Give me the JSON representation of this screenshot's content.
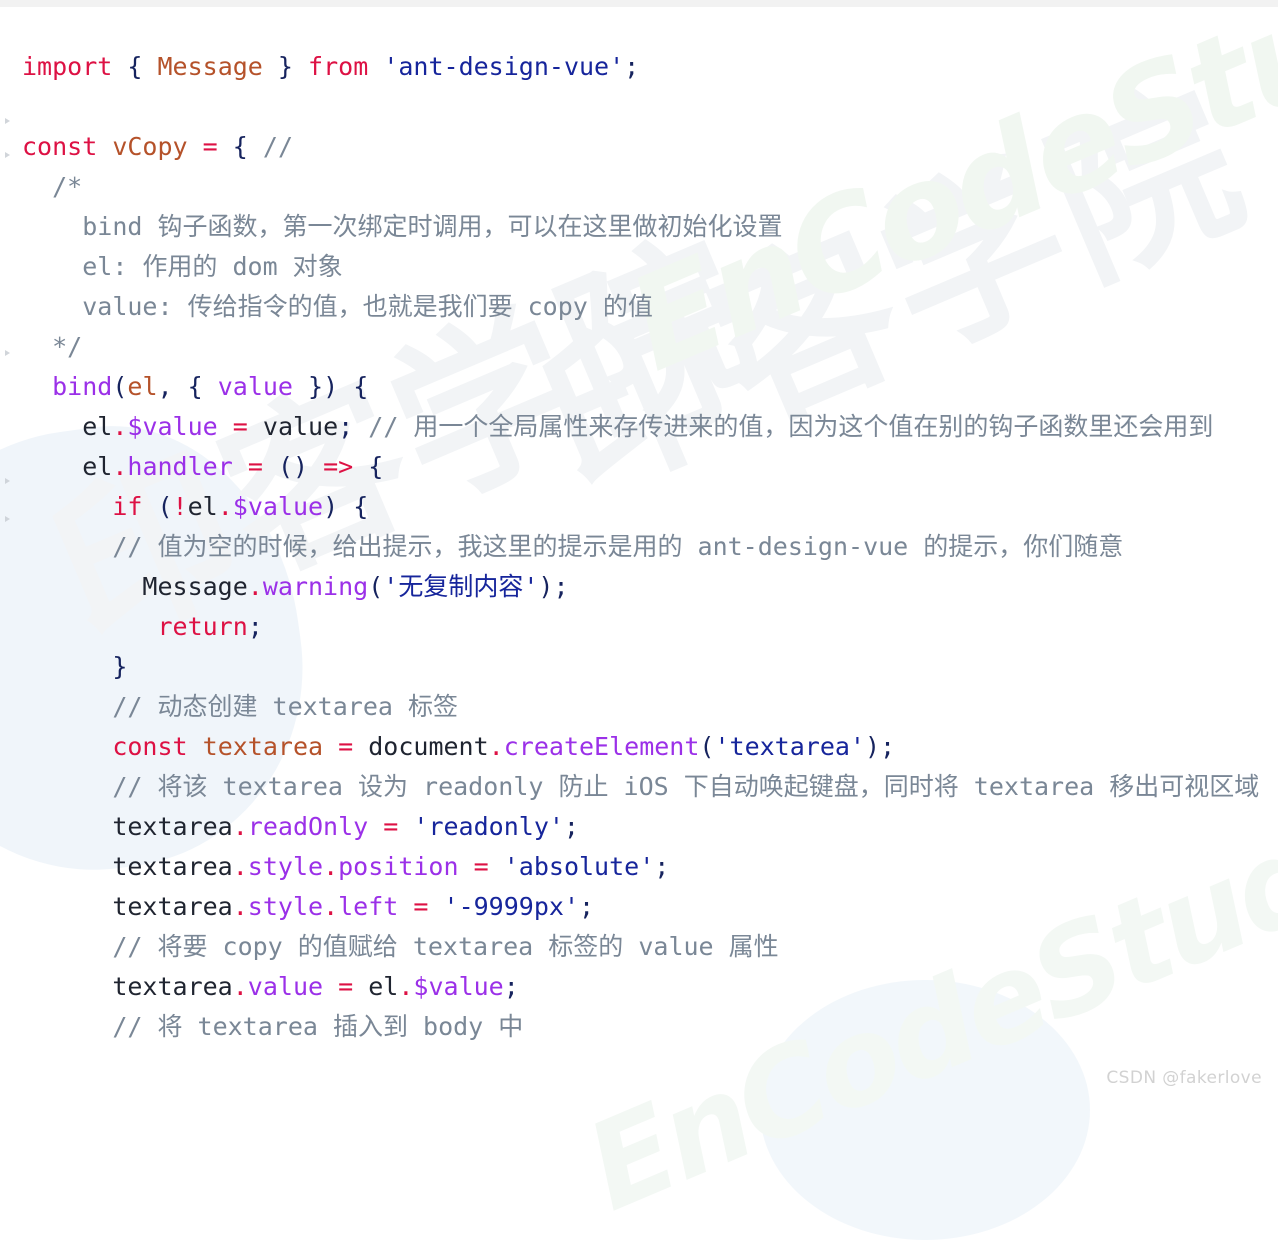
{
  "page": {
    "background_color": "#ffffff",
    "top_strip_color": "#f2f2f2"
  },
  "watermarks": {
    "brand_latin": "EnCodeStudio",
    "brand_cn": "印客学院",
    "latin_color": "#f1f7f1",
    "cn_color": "#f2f4f6"
  },
  "attribution": {
    "text": "CSDN @fakerlove",
    "color": "#d2d2d2"
  },
  "gutter": {
    "marker_name": "code-fold-arrow",
    "marker_color": "#c9ced4",
    "marker_tops": [
      118,
      152,
      350,
      478,
      516
    ]
  },
  "syntax_colors": {
    "keyword": "#dd1144",
    "string": "#16259b",
    "comment": "#7a8796",
    "property": "#9b30e8",
    "identifier": "#1f2430",
    "class": "#b5522a",
    "punctuation": "#16235e"
  },
  "code": {
    "language": "javascript",
    "lines": [
      {
        "id": "line-import",
        "tokens": [
          {
            "t": "import",
            "c": "k"
          },
          {
            "t": " ",
            "c": "pun"
          },
          {
            "t": "{",
            "c": "pun"
          },
          {
            "t": " ",
            "c": "pun"
          },
          {
            "t": "Message",
            "c": "cls"
          },
          {
            "t": " ",
            "c": "pun"
          },
          {
            "t": "}",
            "c": "pun"
          },
          {
            "t": " ",
            "c": "pun"
          },
          {
            "t": "from",
            "c": "k"
          },
          {
            "t": " ",
            "c": "pun"
          },
          {
            "t": "'ant-design-vue'",
            "c": "str"
          },
          {
            "t": ";",
            "c": "pun"
          }
        ]
      },
      {
        "id": "line-blank-1",
        "blank": true
      },
      {
        "id": "line-const-vcopy",
        "tokens": [
          {
            "t": "const",
            "c": "k"
          },
          {
            "t": " ",
            "c": "pun"
          },
          {
            "t": "vCopy",
            "c": "cls"
          },
          {
            "t": " ",
            "c": "pun"
          },
          {
            "t": "=",
            "c": "op"
          },
          {
            "t": " ",
            "c": "pun"
          },
          {
            "t": "{",
            "c": "pun"
          },
          {
            "t": " ",
            "c": "pun"
          },
          {
            "t": "//",
            "c": "cmt"
          }
        ]
      },
      {
        "id": "line-comment-open",
        "tokens": [
          {
            "t": "  /*",
            "c": "cmt"
          }
        ]
      },
      {
        "id": "line-comment-bind",
        "tokens": [
          {
            "t": "    bind 钩子函数，第一次绑定时调用，可以在这里做初始化设置",
            "c": "cmt"
          }
        ]
      },
      {
        "id": "line-comment-el",
        "tokens": [
          {
            "t": "    el: 作用的 dom 对象",
            "c": "cmt"
          }
        ]
      },
      {
        "id": "line-comment-value",
        "tokens": [
          {
            "t": "    value: 传给指令的值，也就是我们要 copy 的值",
            "c": "cmt"
          }
        ]
      },
      {
        "id": "line-comment-close",
        "tokens": [
          {
            "t": "  */",
            "c": "cmt"
          }
        ]
      },
      {
        "id": "line-bind-signature",
        "tokens": [
          {
            "t": "  ",
            "c": "pun"
          },
          {
            "t": "bind",
            "c": "fn"
          },
          {
            "t": "(",
            "c": "pun"
          },
          {
            "t": "el",
            "c": "cls"
          },
          {
            "t": ", ",
            "c": "pun"
          },
          {
            "t": "{ ",
            "c": "pun"
          },
          {
            "t": "value",
            "c": "prop"
          },
          {
            "t": " }",
            "c": "pun"
          },
          {
            "t": ") ",
            "c": "pun"
          },
          {
            "t": "{",
            "c": "pun"
          }
        ]
      },
      {
        "id": "line-el-value-assign",
        "tokens": [
          {
            "t": "    ",
            "c": "pun"
          },
          {
            "t": "el",
            "c": "var"
          },
          {
            "t": ".",
            "c": "dot"
          },
          {
            "t": "$value",
            "c": "prop"
          },
          {
            "t": " ",
            "c": "pun"
          },
          {
            "t": "=",
            "c": "op"
          },
          {
            "t": " ",
            "c": "pun"
          },
          {
            "t": "value",
            "c": "var"
          },
          {
            "t": ";",
            "c": "pun"
          },
          {
            "t": " // 用一个全局属性来存传进来的值，因为这个值在别的钩子函数里还会用到",
            "c": "cmt"
          }
        ]
      },
      {
        "id": "line-el-handler",
        "tokens": [
          {
            "t": "    ",
            "c": "pun"
          },
          {
            "t": "el",
            "c": "var"
          },
          {
            "t": ".",
            "c": "dot"
          },
          {
            "t": "handler",
            "c": "prop"
          },
          {
            "t": " ",
            "c": "pun"
          },
          {
            "t": "=",
            "c": "op"
          },
          {
            "t": " ",
            "c": "pun"
          },
          {
            "t": "() ",
            "c": "pun"
          },
          {
            "t": "=>",
            "c": "op"
          },
          {
            "t": " ",
            "c": "pun"
          },
          {
            "t": "{",
            "c": "pun"
          }
        ]
      },
      {
        "id": "line-if-novalue",
        "tokens": [
          {
            "t": "      ",
            "c": "pun"
          },
          {
            "t": "if",
            "c": "k"
          },
          {
            "t": " (",
            "c": "pun"
          },
          {
            "t": "!",
            "c": "op"
          },
          {
            "t": "el",
            "c": "var"
          },
          {
            "t": ".",
            "c": "dot"
          },
          {
            "t": "$value",
            "c": "prop"
          },
          {
            "t": ") ",
            "c": "pun"
          },
          {
            "t": "{",
            "c": "pun"
          }
        ]
      },
      {
        "id": "line-comment-empty-tip",
        "tokens": [
          {
            "t": "      // 值为空的时候，给出提示，我这里的提示是用的 ant-design-vue 的提示，你们随意",
            "c": "cmt"
          }
        ]
      },
      {
        "id": "line-message-warning",
        "tokens": [
          {
            "t": "        ",
            "c": "pun"
          },
          {
            "t": "Message",
            "c": "var"
          },
          {
            "t": ".",
            "c": "dot"
          },
          {
            "t": "warning",
            "c": "fn"
          },
          {
            "t": "(",
            "c": "pun"
          },
          {
            "t": "'无复制内容'",
            "c": "str"
          },
          {
            "t": ")",
            "c": "pun"
          },
          {
            "t": ";",
            "c": "pun"
          }
        ]
      },
      {
        "id": "line-return",
        "tokens": [
          {
            "t": "         ",
            "c": "pun"
          },
          {
            "t": "return",
            "c": "k"
          },
          {
            "t": ";",
            "c": "pun"
          }
        ]
      },
      {
        "id": "line-close-if",
        "tokens": [
          {
            "t": "      }",
            "c": "pun"
          }
        ]
      },
      {
        "id": "line-comment-create-textarea",
        "tokens": [
          {
            "t": "      // 动态创建 textarea 标签",
            "c": "cmt"
          }
        ]
      },
      {
        "id": "line-const-textarea",
        "tokens": [
          {
            "t": "      ",
            "c": "pun"
          },
          {
            "t": "const",
            "c": "k"
          },
          {
            "t": " ",
            "c": "pun"
          },
          {
            "t": "textarea",
            "c": "cls"
          },
          {
            "t": " ",
            "c": "pun"
          },
          {
            "t": "=",
            "c": "op"
          },
          {
            "t": " ",
            "c": "pun"
          },
          {
            "t": "document",
            "c": "var"
          },
          {
            "t": ".",
            "c": "dot"
          },
          {
            "t": "createElement",
            "c": "fn"
          },
          {
            "t": "(",
            "c": "pun"
          },
          {
            "t": "'textarea'",
            "c": "str"
          },
          {
            "t": ")",
            "c": "pun"
          },
          {
            "t": ";",
            "c": "pun"
          }
        ]
      },
      {
        "id": "line-comment-readonly",
        "tokens": [
          {
            "t": "      // 将该 textarea 设为 readonly 防止 iOS 下自动唤起键盘，同时将 textarea 移出可视区域",
            "c": "cmt"
          }
        ]
      },
      {
        "id": "line-textarea-readonly",
        "tokens": [
          {
            "t": "      ",
            "c": "pun"
          },
          {
            "t": "textarea",
            "c": "var"
          },
          {
            "t": ".",
            "c": "dot"
          },
          {
            "t": "readOnly",
            "c": "prop"
          },
          {
            "t": " ",
            "c": "pun"
          },
          {
            "t": "=",
            "c": "op"
          },
          {
            "t": " ",
            "c": "pun"
          },
          {
            "t": "'readonly'",
            "c": "str"
          },
          {
            "t": ";",
            "c": "pun"
          }
        ]
      },
      {
        "id": "line-textarea-position",
        "tokens": [
          {
            "t": "      ",
            "c": "pun"
          },
          {
            "t": "textarea",
            "c": "var"
          },
          {
            "t": ".",
            "c": "dot"
          },
          {
            "t": "style",
            "c": "prop"
          },
          {
            "t": ".",
            "c": "dot"
          },
          {
            "t": "position",
            "c": "prop"
          },
          {
            "t": " ",
            "c": "pun"
          },
          {
            "t": "=",
            "c": "op"
          },
          {
            "t": " ",
            "c": "pun"
          },
          {
            "t": "'absolute'",
            "c": "str"
          },
          {
            "t": ";",
            "c": "pun"
          }
        ]
      },
      {
        "id": "line-textarea-left",
        "tokens": [
          {
            "t": "      ",
            "c": "pun"
          },
          {
            "t": "textarea",
            "c": "var"
          },
          {
            "t": ".",
            "c": "dot"
          },
          {
            "t": "style",
            "c": "prop"
          },
          {
            "t": ".",
            "c": "dot"
          },
          {
            "t": "left",
            "c": "prop"
          },
          {
            "t": " ",
            "c": "pun"
          },
          {
            "t": "=",
            "c": "op"
          },
          {
            "t": " ",
            "c": "pun"
          },
          {
            "t": "'-9999px'",
            "c": "str"
          },
          {
            "t": ";",
            "c": "pun"
          }
        ]
      },
      {
        "id": "line-comment-assign-value",
        "tokens": [
          {
            "t": "      // 将要 copy 的值赋给 textarea 标签的 value 属性",
            "c": "cmt"
          }
        ]
      },
      {
        "id": "line-textarea-value",
        "tokens": [
          {
            "t": "      ",
            "c": "pun"
          },
          {
            "t": "textarea",
            "c": "var"
          },
          {
            "t": ".",
            "c": "dot"
          },
          {
            "t": "value",
            "c": "prop"
          },
          {
            "t": " ",
            "c": "pun"
          },
          {
            "t": "=",
            "c": "op"
          },
          {
            "t": " ",
            "c": "pun"
          },
          {
            "t": "el",
            "c": "var"
          },
          {
            "t": ".",
            "c": "dot"
          },
          {
            "t": "$value",
            "c": "prop"
          },
          {
            "t": ";",
            "c": "pun"
          }
        ]
      },
      {
        "id": "line-comment-insert-body",
        "tokens": [
          {
            "t": "      // 将 textarea 插入到 body 中",
            "c": "cmt"
          }
        ]
      }
    ]
  }
}
